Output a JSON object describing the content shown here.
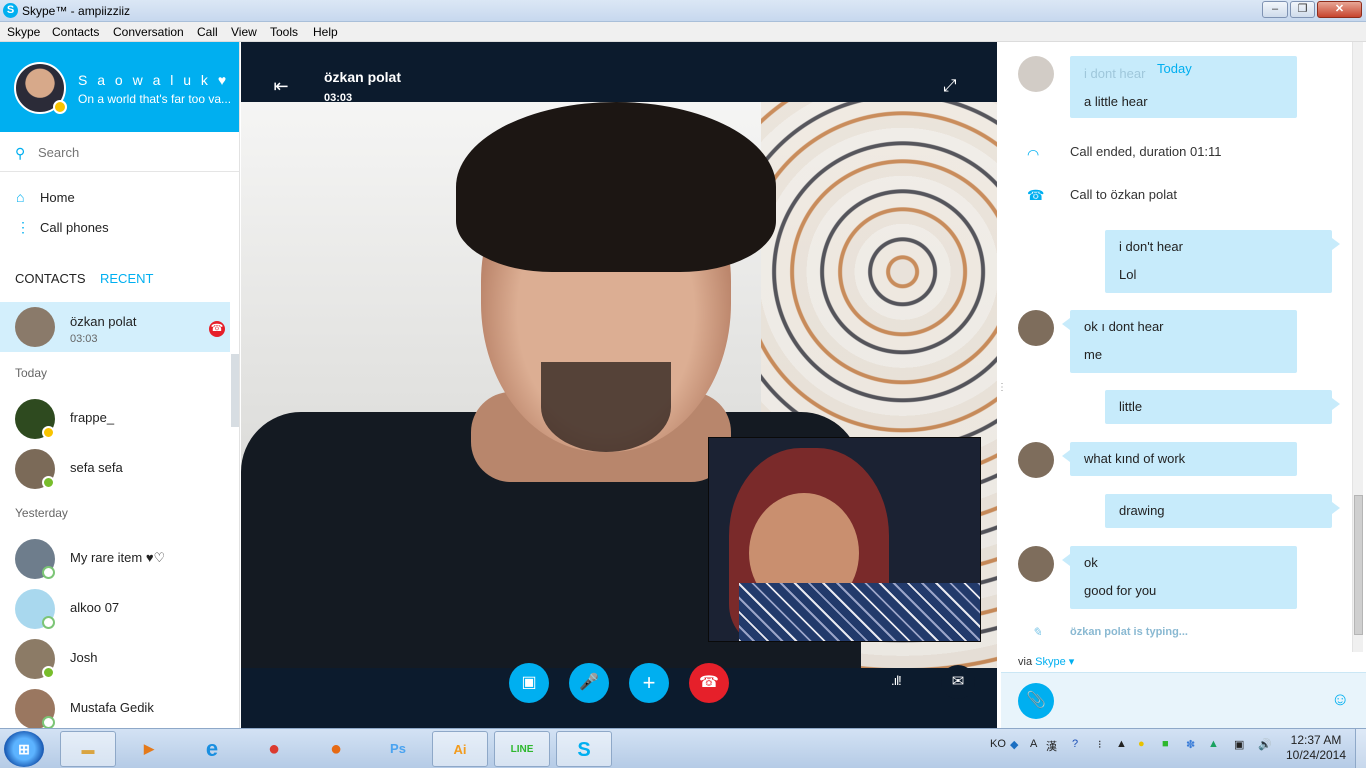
{
  "window": {
    "title": "Skype™ - ampiizziiz",
    "controls": [
      "–",
      "❐",
      "✕"
    ]
  },
  "menu": [
    "Skype",
    "Contacts",
    "Conversation",
    "Call",
    "View",
    "Tools",
    "Help"
  ],
  "profile": {
    "name": "S a o w a l u k ♥",
    "mood": "On a world that's far too va...",
    "status_color": "#f8c400"
  },
  "search": {
    "placeholder": "Search"
  },
  "nav": [
    {
      "label": "Home",
      "icon": "home-icon"
    },
    {
      "label": "Call phones",
      "icon": "dialpad-icon"
    }
  ],
  "tabs": {
    "contacts": "CONTACTS",
    "recent": "RECENT"
  },
  "active_contact": {
    "name": "özkan polat",
    "duration": "03:03"
  },
  "sections": {
    "today": "Today",
    "yesterday": "Yesterday"
  },
  "contacts_today": [
    {
      "name": "frappe_",
      "status": "away"
    },
    {
      "name": "sefa sefa",
      "status": "online"
    }
  ],
  "contacts_yesterday": [
    {
      "name": "My rare item ♥♡",
      "status": "offline"
    },
    {
      "name": "alkoo 07",
      "status": "offline"
    },
    {
      "name": "Josh",
      "status": "online"
    },
    {
      "name": "Mustafa Gedik",
      "status": "offline"
    }
  ],
  "call": {
    "name": "özkan polat",
    "time": "03:03"
  },
  "chat": {
    "today_label": "Today",
    "partial_message": "a little hear",
    "partial_hidden": "i dont hear",
    "call_ended": "Call ended, duration 01:11",
    "call_to": "Call to özkan polat",
    "messages": [
      {
        "side": "right",
        "lines": [
          "i don't hear",
          "Lol"
        ]
      },
      {
        "side": "left",
        "lines": [
          "ok ı dont hear",
          "me"
        ]
      },
      {
        "side": "right",
        "lines": [
          "little"
        ]
      },
      {
        "side": "left",
        "lines": [
          "what kınd of work"
        ]
      },
      {
        "side": "right",
        "lines": [
          "drawing"
        ]
      },
      {
        "side": "left",
        "lines": [
          "ok",
          "good for you"
        ]
      }
    ],
    "typing": "özkan polat is typing...",
    "via_prefix": "via",
    "via_link": "Skype",
    "input_value": ""
  },
  "taskbar": {
    "apps": [
      "explorer",
      "media-player",
      "internet-explorer",
      "chrome",
      "firefox",
      "Ps",
      "Ai",
      "LINE",
      "skype"
    ],
    "lang": "KO",
    "time": "12:37 AM",
    "date": "10/24/2014"
  },
  "colors": {
    "accent": "#00aff0",
    "end_call": "#e6202a",
    "bubble": "#c7ebfb"
  }
}
